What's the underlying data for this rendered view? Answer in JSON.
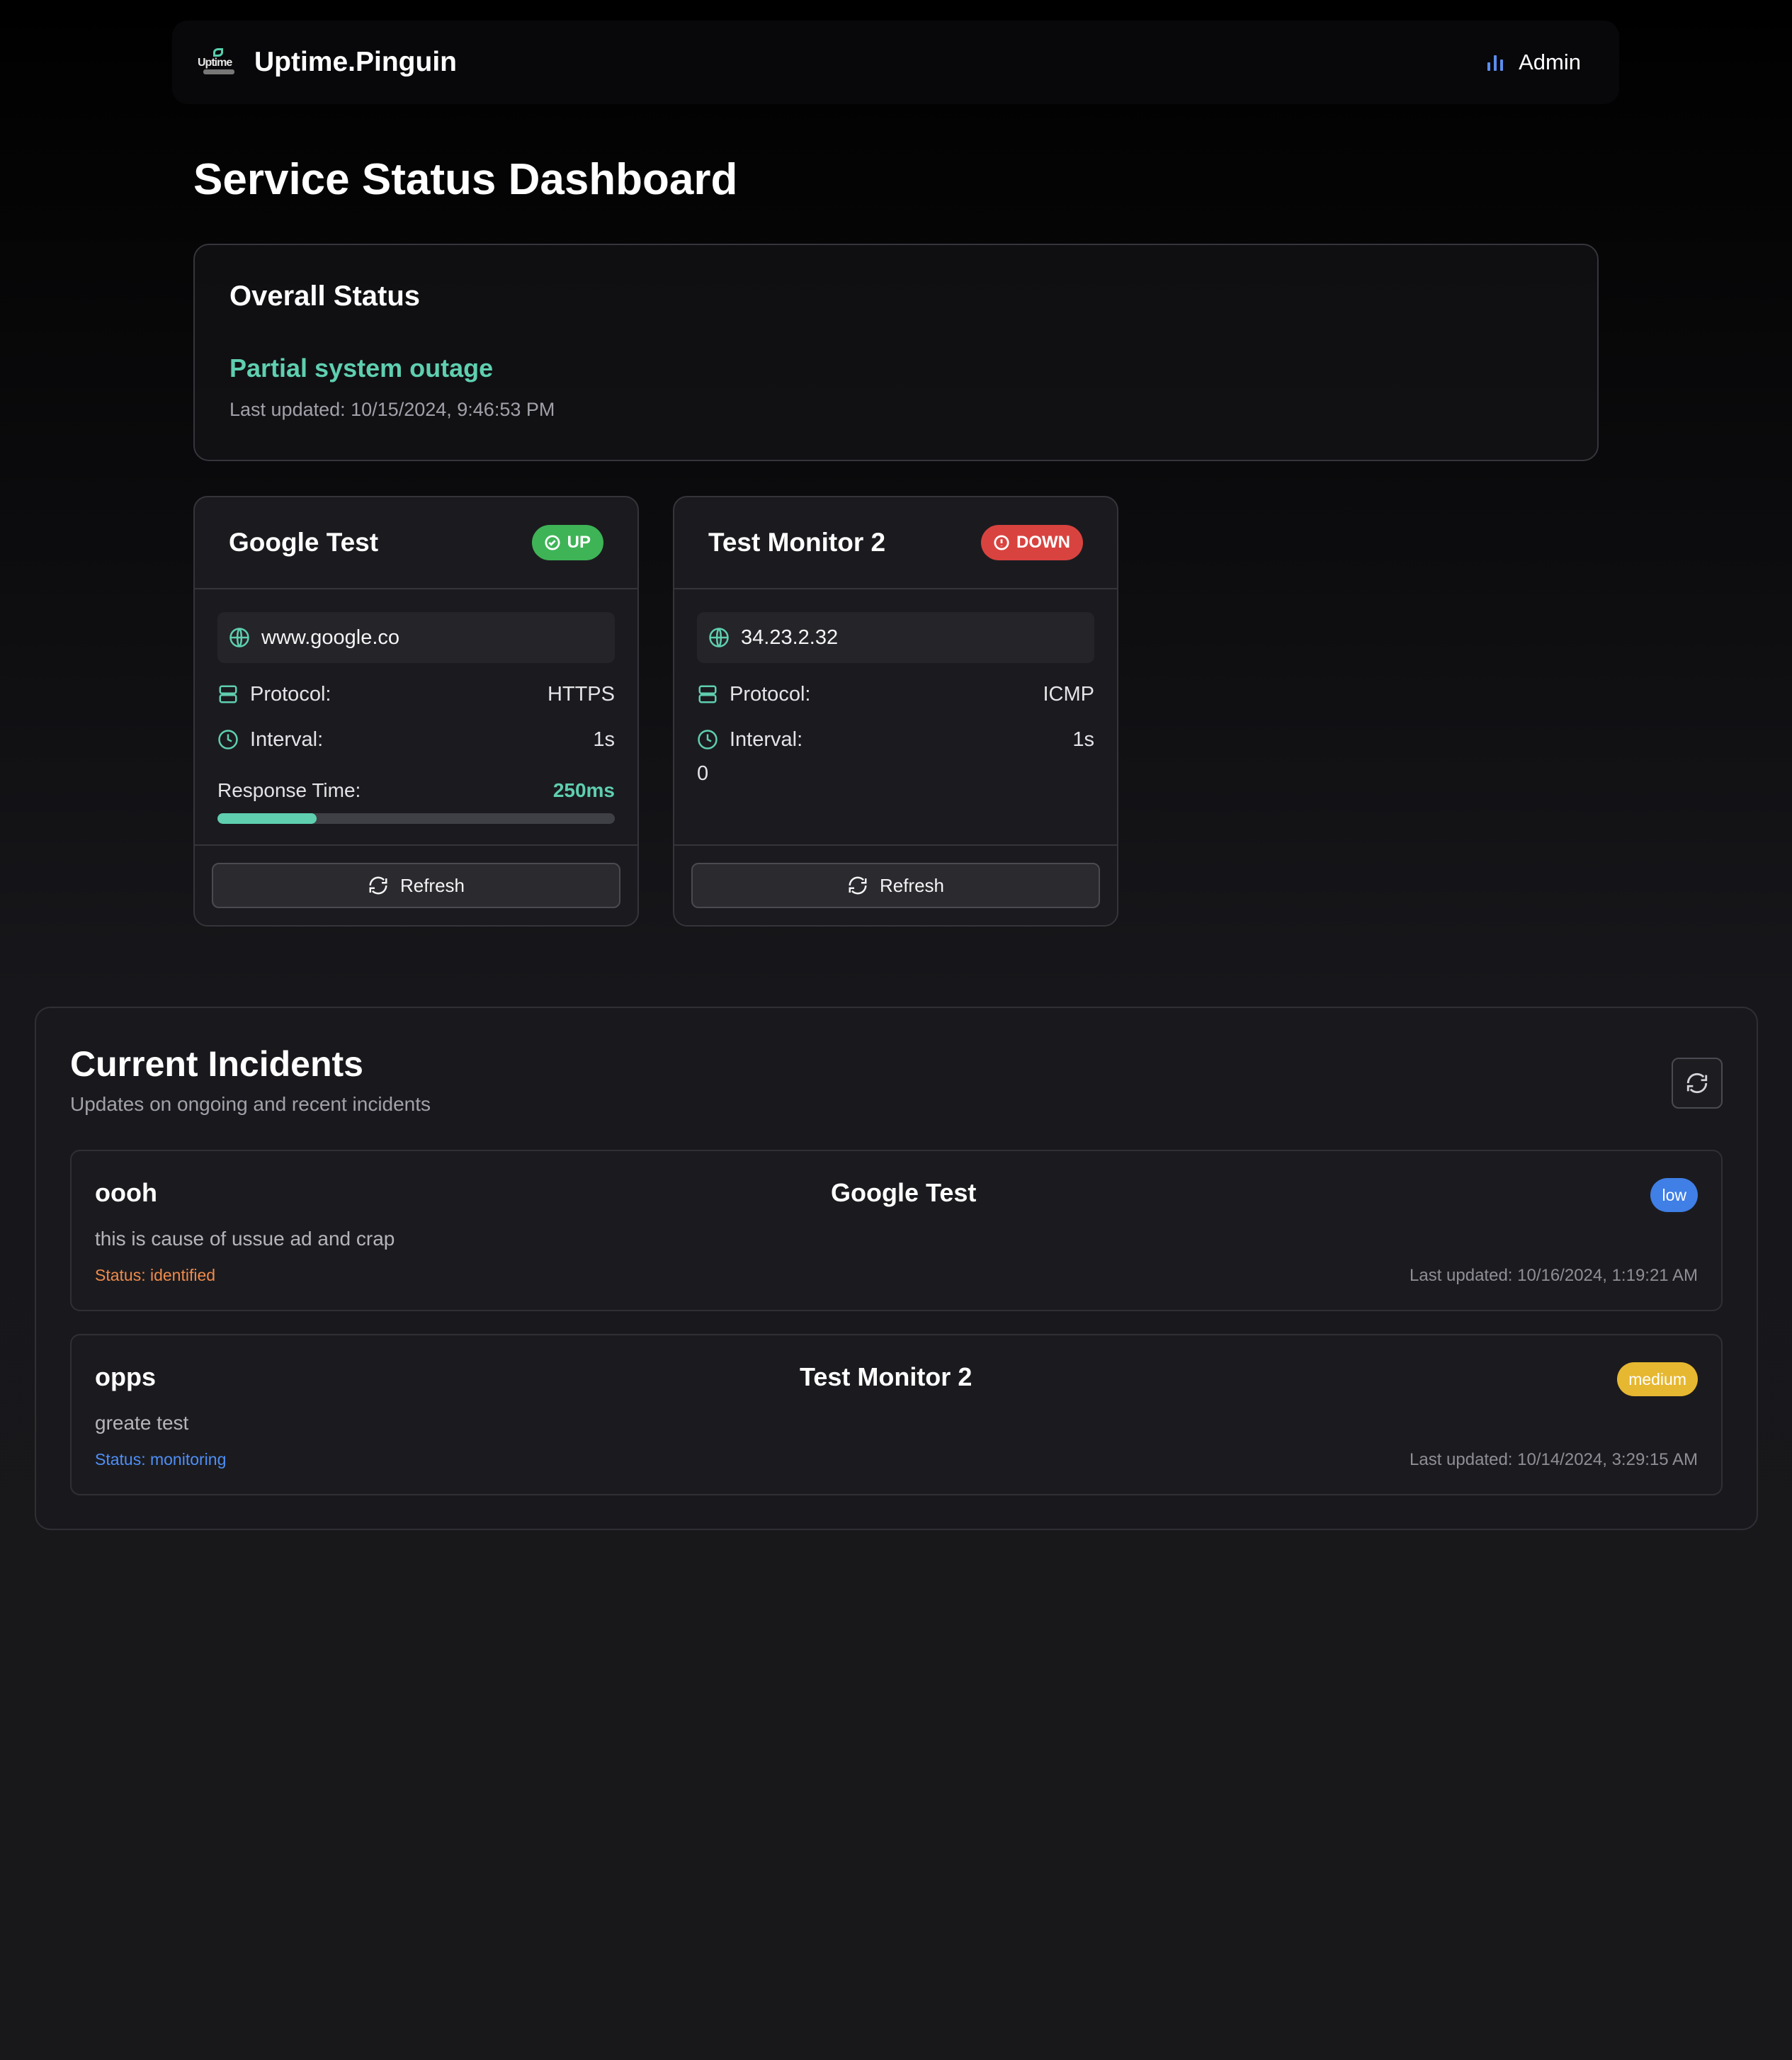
{
  "nav": {
    "brand": "Uptime.Pinguin",
    "logo_text": "Uptime",
    "admin_label": "Admin"
  },
  "page": {
    "title": "Service Status Dashboard"
  },
  "overall": {
    "heading": "Overall Status",
    "state": "Partial system outage",
    "updated": "Last updated: 10/15/2024, 9:46:53 PM"
  },
  "monitors": [
    {
      "name": "Google Test",
      "status": "UP",
      "host": "www.google.co",
      "protocol_label": "Protocol:",
      "protocol": "HTTPS",
      "interval_label": "Interval:",
      "interval": "1s",
      "response_label": "Response Time:",
      "response_value": "250ms",
      "response_fraction": 0.25,
      "refresh_label": "Refresh"
    },
    {
      "name": "Test Monitor 2",
      "status": "DOWN",
      "host": "34.23.2.32",
      "protocol_label": "Protocol:",
      "protocol": "ICMP",
      "interval_label": "Interval:",
      "interval": "1s",
      "extra": "0",
      "refresh_label": "Refresh"
    }
  ],
  "incidents": {
    "heading": "Current Incidents",
    "subtitle": "Updates on ongoing and recent incidents",
    "items": [
      {
        "name": "oooh",
        "service": "Google Test",
        "severity": "low",
        "description": "this is cause of ussue ad and crap",
        "status": "Status: identified",
        "updated": "Last updated: 10/16/2024, 1:19:21 AM"
      },
      {
        "name": "opps",
        "service": "Test Monitor 2",
        "severity": "medium",
        "description": "greate test",
        "status": "Status: monitoring",
        "updated": "Last updated: 10/14/2024, 3:29:15 AM"
      }
    ]
  },
  "colors": {
    "accent": "#5fcfb0",
    "up": "#3eb456",
    "down": "#d9433f",
    "low": "#3f7fe6",
    "medium": "#e6b730",
    "status_identified": "#f08a4b",
    "status_monitoring": "#4f8ff7"
  }
}
